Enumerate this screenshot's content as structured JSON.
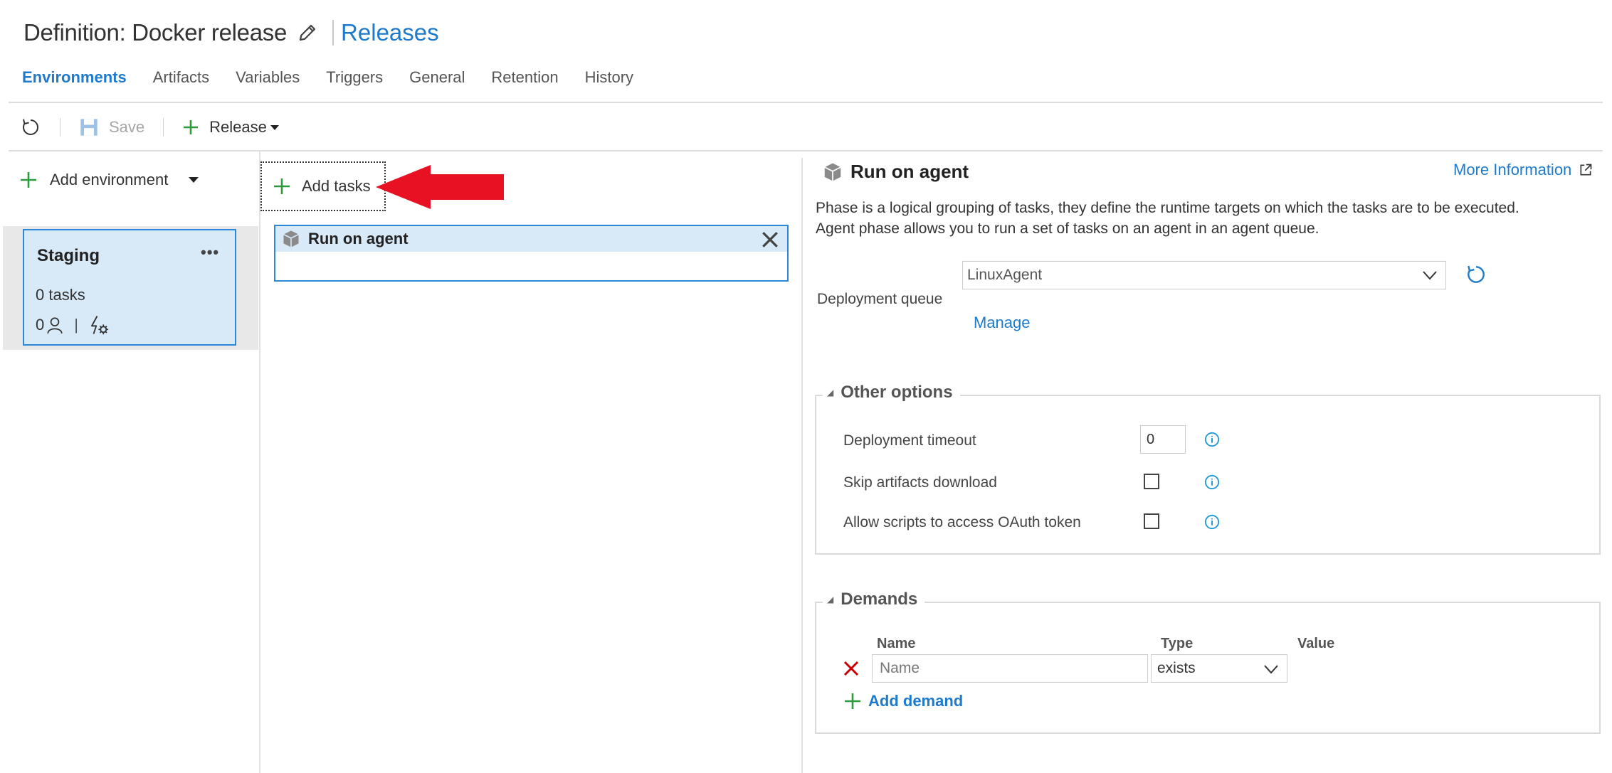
{
  "header": {
    "title": "Definition: Docker release",
    "releases_link": "Releases"
  },
  "tabs": [
    {
      "label": "Environments",
      "active": true
    },
    {
      "label": "Artifacts"
    },
    {
      "label": "Variables"
    },
    {
      "label": "Triggers"
    },
    {
      "label": "General"
    },
    {
      "label": "Retention"
    },
    {
      "label": "History"
    }
  ],
  "toolbar": {
    "refresh_icon": "refresh-icon",
    "save_label": "Save",
    "release_label": "Release"
  },
  "environments": {
    "add_label": "Add environment",
    "items": [
      {
        "name": "Staging",
        "more": "•••",
        "tasks": "0 tasks",
        "approvers_count": "0",
        "separator": "|"
      }
    ]
  },
  "tasks_panel": {
    "add_tasks_label": "Add tasks",
    "phase_title": "Run on agent"
  },
  "details": {
    "title": "Run on agent",
    "more_info": "More Information",
    "description_1": "Phase is a logical grouping of tasks, they define the runtime targets on which the tasks are to be executed.",
    "description_2": "Agent phase allows you to run a set of tasks on an agent in an agent queue.",
    "deployment_queue_label": "Deployment queue",
    "deployment_queue_value": "LinuxAgent",
    "manage_link": "Manage",
    "other_options": {
      "legend": "Other options",
      "deployment_timeout_label": "Deployment timeout",
      "deployment_timeout_value": "0",
      "skip_artifacts_label": "Skip artifacts download",
      "skip_artifacts_checked": false,
      "allow_scripts_label": "Allow scripts to access OAuth token",
      "allow_scripts_checked": false
    },
    "demands": {
      "legend": "Demands",
      "col_name": "Name",
      "col_type": "Type",
      "col_value": "Value",
      "row_name_placeholder": "Name",
      "row_type": "exists",
      "add_demand": "Add demand"
    }
  },
  "colors": {
    "accent": "#1e7acb",
    "selected_bg": "#d8e9f8",
    "add_green": "#2e9a3e",
    "delete_red": "#c80000",
    "annotation_arrow": "#e81123"
  }
}
